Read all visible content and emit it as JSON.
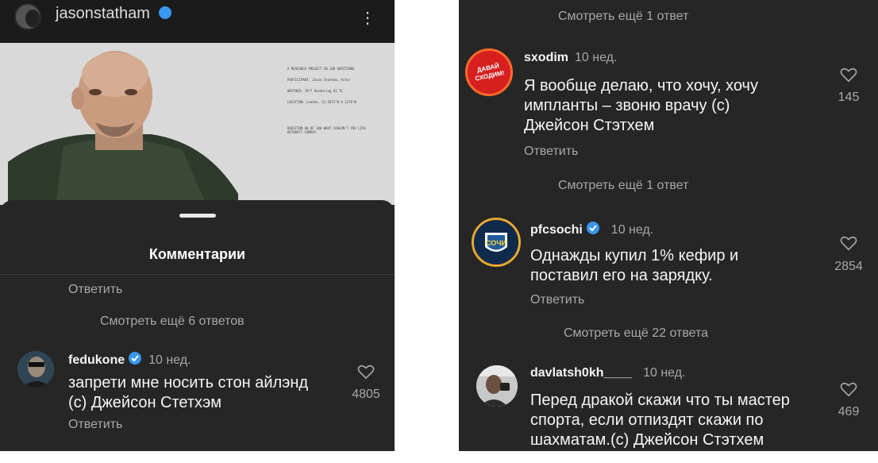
{
  "left": {
    "header": {
      "username": "jasonstatham",
      "menu_icon": "more-vertical-icon"
    },
    "post_doc": {
      "lines": [
        "A RESEARCH PROJECT IN 100 QUESTIONS",
        "PARTICIPANT: Jason Statham, Actor",
        "WEATHER: 78°F Rendering 61 TC",
        "LOCATION: London, 51.5072°N 0.1276°W",
        "QUESTION 80 OF 100 WHAT COULDN'T YOU LIVE WITHOUT? COMEDY."
      ]
    },
    "sheet": {
      "title": "Комментарии",
      "reply_top": "Ответить",
      "view_more": "Смотреть ещё 6 ответов",
      "comment": {
        "username": "fedukone",
        "time": "10 нед.",
        "text_line1": "запрети мне носить стон айлэнд",
        "text_line2": "(с) Джейсон Стетхэм",
        "likes": "4805",
        "reply": "Ответить"
      }
    }
  },
  "right": {
    "view_more_1": "Смотреть ещё 1 ответ",
    "comment1": {
      "username": "sxodim",
      "avatar_text": "ДАВАЙ СХОДИМ!",
      "time": "10 нед.",
      "text_line1": "Я вообще делаю, что хочу, хочу",
      "text_line2": "импланты – звоню врачу (с)",
      "text_line3": "Джейсон Стэтхем",
      "likes": "145",
      "reply": "Ответить"
    },
    "view_more_2": "Смотреть ещё 1 ответ",
    "comment2": {
      "username": "pfcsochi",
      "time": "10 нед.",
      "text_line1": "Однажды купил 1% кефир и",
      "text_line2": "поставил его на зарядку.",
      "likes": "2854",
      "reply": "Ответить"
    },
    "view_more_3": "Смотреть ещё 22 ответа",
    "comment3": {
      "username": "davlatsh0kh____",
      "time": "10 нед.",
      "text_line1": "Перед дракой скажи что ты мастер",
      "text_line2": "спорта, если отпиздят скажи по",
      "text_line3": "шахматам.(с) Джейсон Стэтхем",
      "likes": "469"
    }
  },
  "colors": {
    "background": "#262626",
    "text": "#f5f5f5",
    "muted": "#a8a8a8",
    "verified": "#3897f0"
  }
}
